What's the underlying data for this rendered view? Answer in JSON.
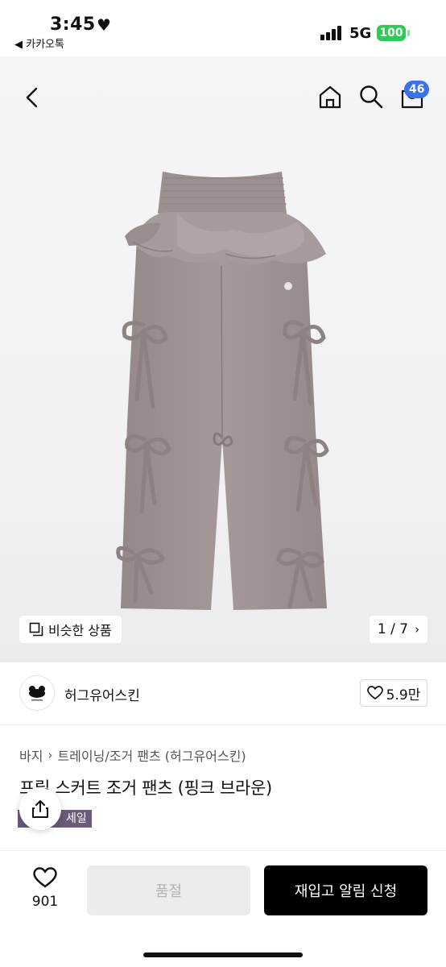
{
  "status_bar": {
    "time": "3:45",
    "back_app": "◀ 카카오톡",
    "network": "5G",
    "battery": "100",
    "icons": [
      "heart-icon",
      "signal-icon"
    ]
  },
  "nav": {
    "cart_count": "46",
    "icons": [
      "back-icon",
      "home-icon",
      "search-icon",
      "cart-icon"
    ]
  },
  "gallery": {
    "similar_label": "비슷한 상품",
    "page_indicator": "1 / 7"
  },
  "brand": {
    "name": "허그유어스킨",
    "likes": "5.9만"
  },
  "product": {
    "breadcrumb": [
      "바지",
      "트레이닝/조거 팬츠 (허그유어스킨)"
    ],
    "title": "프릴 스커트 조거 팬츠 (핑크 브라운)",
    "tag": "세일"
  },
  "bottom_bar": {
    "wish_count": "901",
    "soldout_label": "품절",
    "restock_label": "재입고 알림 신청"
  },
  "colors": {
    "accent_badge": "#3b73e6",
    "product_fabric": "#a09494",
    "primary_button": "#000000",
    "sale_tag": "#6b5a7b"
  }
}
